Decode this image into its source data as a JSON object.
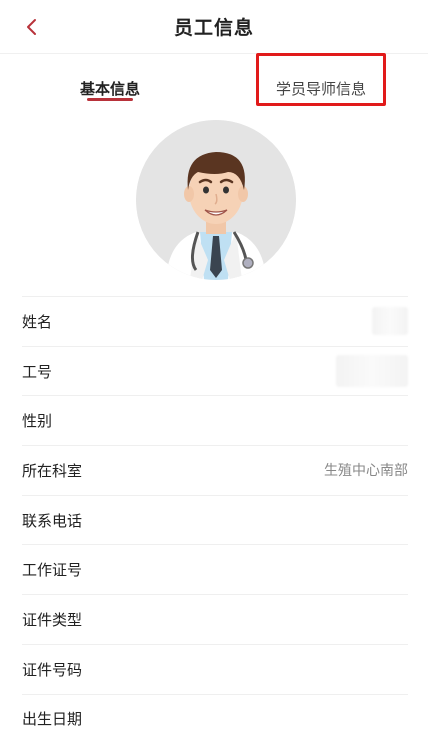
{
  "header": {
    "title": "员工信息"
  },
  "tabs": [
    {
      "label": "基本信息"
    },
    {
      "label": "学员导师信息"
    }
  ],
  "fields": [
    {
      "label": "姓名",
      "value": ""
    },
    {
      "label": "工号",
      "value": ""
    },
    {
      "label": "性别",
      "value": ""
    },
    {
      "label": "所在科室",
      "value": "生殖中心南部"
    },
    {
      "label": "联系电话",
      "value": ""
    },
    {
      "label": "工作证号",
      "value": ""
    },
    {
      "label": "证件类型",
      "value": ""
    },
    {
      "label": "证件号码",
      "value": ""
    },
    {
      "label": "出生日期",
      "value": ""
    }
  ],
  "icons": {
    "back": "chevron-left-icon",
    "avatar": "doctor-avatar-icon"
  },
  "colors": {
    "accent": "#b8323a",
    "highlight": "#e11a1a"
  }
}
